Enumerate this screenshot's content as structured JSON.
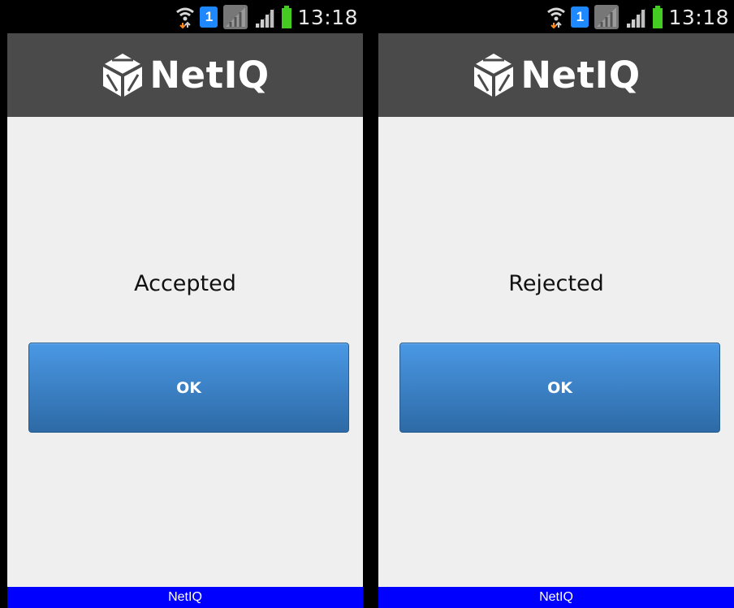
{
  "colors": {
    "status_bar": "#000000",
    "header": "#4a4a4a",
    "content_background": "#efefef",
    "button_top": "#4a98e4",
    "button_bottom": "#2d6aa6",
    "footer": "#0000ff"
  },
  "screens": [
    {
      "status_bar": {
        "time": "13:18",
        "sim_slot": "1",
        "icons": [
          "wifi-icon",
          "sim-icon",
          "no-signal-icon",
          "signal-icon",
          "battery-icon"
        ]
      },
      "header": {
        "logo_text": "NetIQ"
      },
      "result_text": "Accepted",
      "ok_button_label": "OK",
      "footer_text": "NetIQ"
    },
    {
      "status_bar": {
        "time": "13:18",
        "sim_slot": "1",
        "icons": [
          "wifi-icon",
          "sim-icon",
          "no-signal-icon",
          "signal-icon",
          "battery-icon"
        ]
      },
      "header": {
        "logo_text": "NetIQ"
      },
      "result_text": "Rejected",
      "ok_button_label": "OK",
      "footer_text": "NetIQ"
    }
  ]
}
